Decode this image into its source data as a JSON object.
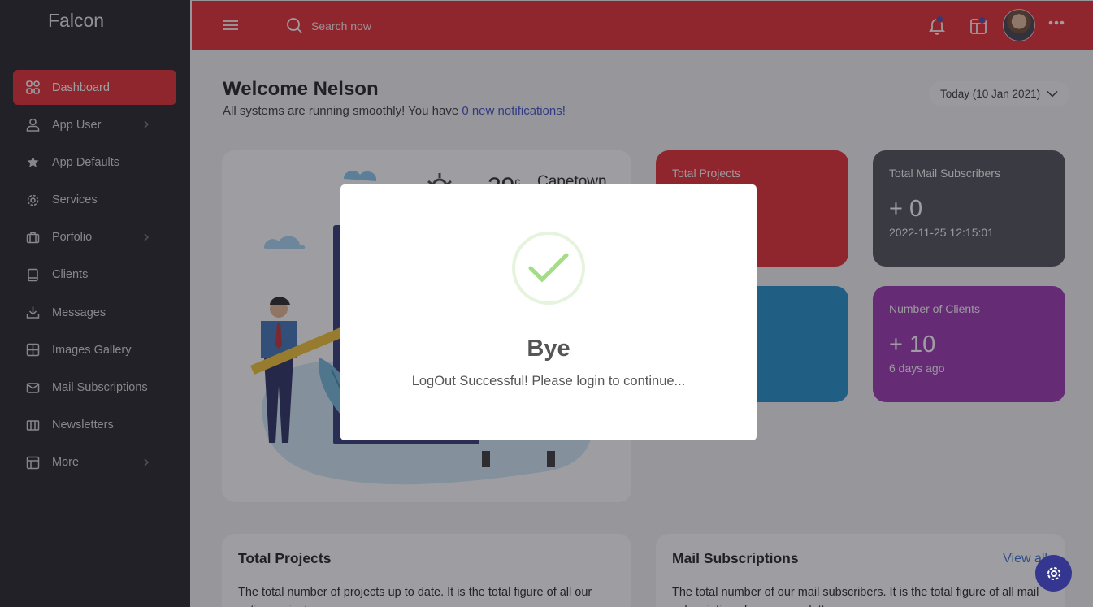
{
  "sidebar": {
    "brand": "Falcon",
    "items": [
      {
        "label": "Dashboard",
        "icon": "dashboard-grid-icon"
      },
      {
        "label": "App User",
        "icon": "user-icon"
      },
      {
        "label": "App Defaults",
        "icon": "star-icon"
      },
      {
        "label": "Services",
        "icon": "gear-icon"
      },
      {
        "label": "Porfolio",
        "icon": "briefcase-icon"
      },
      {
        "label": "Clients",
        "icon": "book-icon"
      },
      {
        "label": "Messages",
        "icon": "download-icon"
      },
      {
        "label": "Images Gallery",
        "icon": "grid-square-icon"
      },
      {
        "label": "Mail Subscriptions",
        "icon": "mail-icon"
      },
      {
        "label": "Newsletters",
        "icon": "columns-icon"
      },
      {
        "label": "More",
        "icon": "layout-icon"
      }
    ]
  },
  "topbar": {
    "search_placeholder": "Search now"
  },
  "main": {
    "welcome": "Welcome Nelson",
    "subtitle_prefix": "All systems are running smoothly! You have ",
    "subtitle_link": "0 new notifications!",
    "date_selector": "Today (10 Jan 2021)",
    "weather": {
      "temp": "29",
      "unit": "c",
      "city": "Capetown"
    },
    "cards": [
      {
        "title": "Total Projects",
        "value": "",
        "sub": "",
        "color": "#e3262c"
      },
      {
        "title": "Total Mail Subscribers",
        "value": "+ 0",
        "sub": "2022-11-25 12:15:01",
        "color": "#4a4c50"
      },
      {
        "title": "",
        "value": "",
        "sub": "",
        "color": "#1d8ac6"
      },
      {
        "title": "Number of Clients",
        "value": "+ 10",
        "sub": "6 days ago",
        "color": "#9a2fae"
      }
    ],
    "bottom": [
      {
        "title": "Total Projects",
        "text": "The total number of projects up to date. It is the total figure of all our active projects.",
        "link": ""
      },
      {
        "title": "Mail Subscriptions",
        "text": "The total number of our mail subscribers. It is the total figure of all mail subscriptions for our newsletters.",
        "link": "View all"
      }
    ]
  },
  "modal": {
    "title": "Bye",
    "text": "LogOut Successful! Please login to continue..."
  },
  "colors": {
    "accent": "#e3262c",
    "sidebar_bg": "#1c1c1f",
    "check_green": "#a5dc86"
  }
}
